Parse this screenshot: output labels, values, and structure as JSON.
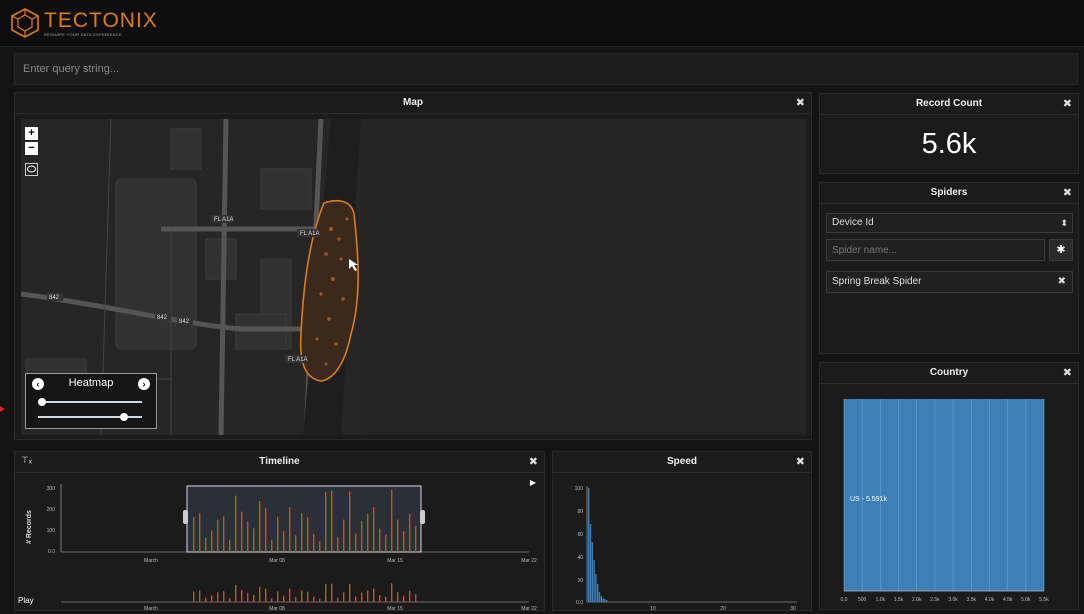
{
  "header": {
    "logo_name": "TECTONIX",
    "logo_tagline": "RESHAPE YOUR DATA EXPERIENCE"
  },
  "query": {
    "placeholder": "Enter query string..."
  },
  "map_panel": {
    "title": "Map",
    "zoom_in": "+",
    "zoom_out": "−",
    "road_labels": [
      "FL A1A",
      "FL A1A",
      "842",
      "842",
      "842",
      "FL A1A"
    ],
    "heatmap": {
      "label": "Heatmap",
      "radius_level": 0.0,
      "intensity_level": 0.85
    }
  },
  "record_count": {
    "title": "Record Count",
    "value": "5.6k"
  },
  "spiders": {
    "title": "Spiders",
    "field_select": "Device Id",
    "name_placeholder": "Spider name...",
    "items": [
      {
        "label": "Spring Break Spider"
      }
    ]
  },
  "country": {
    "title": "Country",
    "bar_label": "US - 5.591k",
    "x_ticks": [
      "0.0",
      "500",
      "1.0k",
      "1.5k",
      "2.0k",
      "2.5k",
      "3.0k",
      "3.5k",
      "4.0k",
      "4.5k",
      "5.0k",
      "5.5k"
    ]
  },
  "timeline": {
    "title": "Timeline",
    "ylabel": "# Records",
    "y_ticks": [
      "300",
      "200",
      "100",
      "0.0"
    ],
    "x_ticks": [
      "March",
      "Mar 08",
      "Mar 15",
      "Mar 22"
    ],
    "mini_x_ticks": [
      "March",
      "Mar 08",
      "Mar 15",
      "Mar 22"
    ]
  },
  "speed": {
    "title": "Speed",
    "y_ticks_top": [
      "100",
      "80",
      "60",
      "40",
      "20",
      "0.0"
    ],
    "x_ticks": [
      "10",
      "20",
      "30"
    ]
  },
  "footer": {
    "play_label": "Play"
  },
  "colors": {
    "accent": "#e07b1a",
    "country_bar": "#3d7fb6",
    "timeline_bar": "#c8502a"
  }
}
